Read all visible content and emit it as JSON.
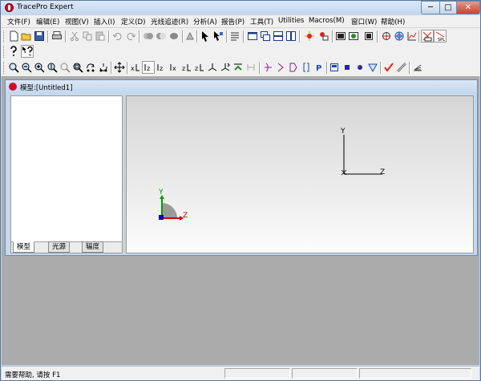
{
  "window": {
    "title": "TracePro Expert",
    "minimize": "─",
    "maximize": "□",
    "close": "✕"
  },
  "menu": [
    "文件(F)",
    "编辑(E)",
    "视图(V)",
    "插入(I)",
    "定义(D)",
    "光线追迹(R)",
    "分析(A)",
    "报告(P)",
    "工具(T)",
    "Utilities",
    "Macros(M)",
    "窗口(W)",
    "帮助(H)"
  ],
  "child_window": {
    "title": "模型:[Untitled1]"
  },
  "tree_tabs": [
    {
      "label": "模型",
      "active": true
    },
    {
      "label": "光源",
      "active": false
    },
    {
      "label": "辐度",
      "active": false
    }
  ],
  "viewport": {
    "background": "gradient gray-to-white",
    "main_axes": {
      "y_label": "Y",
      "z_label": "Z"
    },
    "triad": {
      "y_label": "Y",
      "z_label": "Z",
      "y_color": "#00a000",
      "z_color": "#d00000",
      "x_color": "#0000cc"
    }
  },
  "status": {
    "text": "需要帮助, 请按 F1"
  },
  "colors": {
    "accent": "#c8102e",
    "window_frame": "#bcd0e6"
  }
}
